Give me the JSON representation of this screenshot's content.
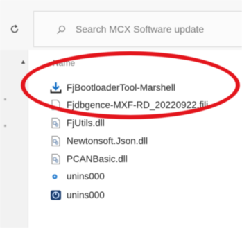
{
  "search": {
    "placeholder": "Search MCX Software update"
  },
  "column_header": "Name",
  "files": [
    {
      "name": "FjBootloaderTool-Marshell",
      "icon": "download-icon"
    },
    {
      "name": "Fjdbgence-MXF-RD_20220922.fjli",
      "icon": "document-icon"
    },
    {
      "name": "FjUtils.dll",
      "icon": "dll-file-icon"
    },
    {
      "name": "Newtonsoft.Json.dll",
      "icon": "dll-file-icon"
    },
    {
      "name": "PCANBasic.dll",
      "icon": "dll-file-icon"
    },
    {
      "name": "unins000",
      "icon": "setup-dat-icon"
    },
    {
      "name": "unins000",
      "icon": "uninstaller-icon"
    }
  ],
  "annotation": {
    "shape": "ellipse",
    "color": "#e3151c",
    "highlights": "FjBootloaderTool-Marshell"
  }
}
